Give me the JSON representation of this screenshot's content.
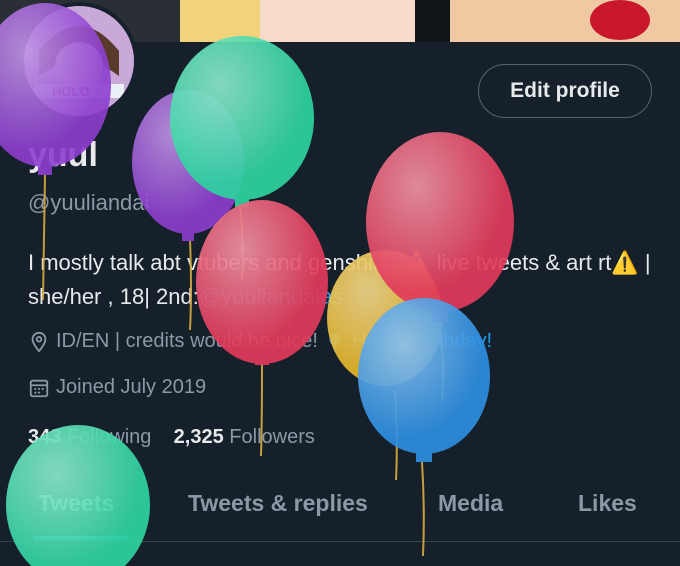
{
  "profile": {
    "name": "yuul",
    "handle": "@yuuliandai",
    "avatar_text": "HOLO",
    "bio_part1": "I mostly talk abt vtubers and genshin | ",
    "bio_warn1": "⚠️",
    "bio_part2": " live tweets & art rt",
    "bio_warn2": "⚠️",
    "bio_part3": " | she/her , 18| 2nd:",
    "bio_link": "@yuuliandaias",
    "location": "ID/EN | credits would be nice! ",
    "birthday_text": "Happy birthday!",
    "joined": "Joined July 2019",
    "following_count": "343",
    "following_label": "Following",
    "followers_count": "2,325",
    "followers_label": "Followers"
  },
  "actions": {
    "edit_profile": "Edit profile"
  },
  "tabs": [
    {
      "label": "Tweets",
      "active": true
    },
    {
      "label": "Tweets & replies",
      "active": false
    },
    {
      "label": "Media",
      "active": false
    },
    {
      "label": "Likes",
      "active": false
    }
  ],
  "colors": {
    "background": "#15202b",
    "accent": "#1d9bf0",
    "balloon_purple": "#8e3fd0",
    "balloon_green": "#2fd3a0",
    "balloon_red": "#e23a5a",
    "balloon_yellow": "#e5b52a",
    "balloon_blue": "#2d8ee0"
  },
  "icons": {
    "location": "location-pin-icon",
    "calendar": "calendar-icon",
    "birthday": "balloon-icon"
  }
}
